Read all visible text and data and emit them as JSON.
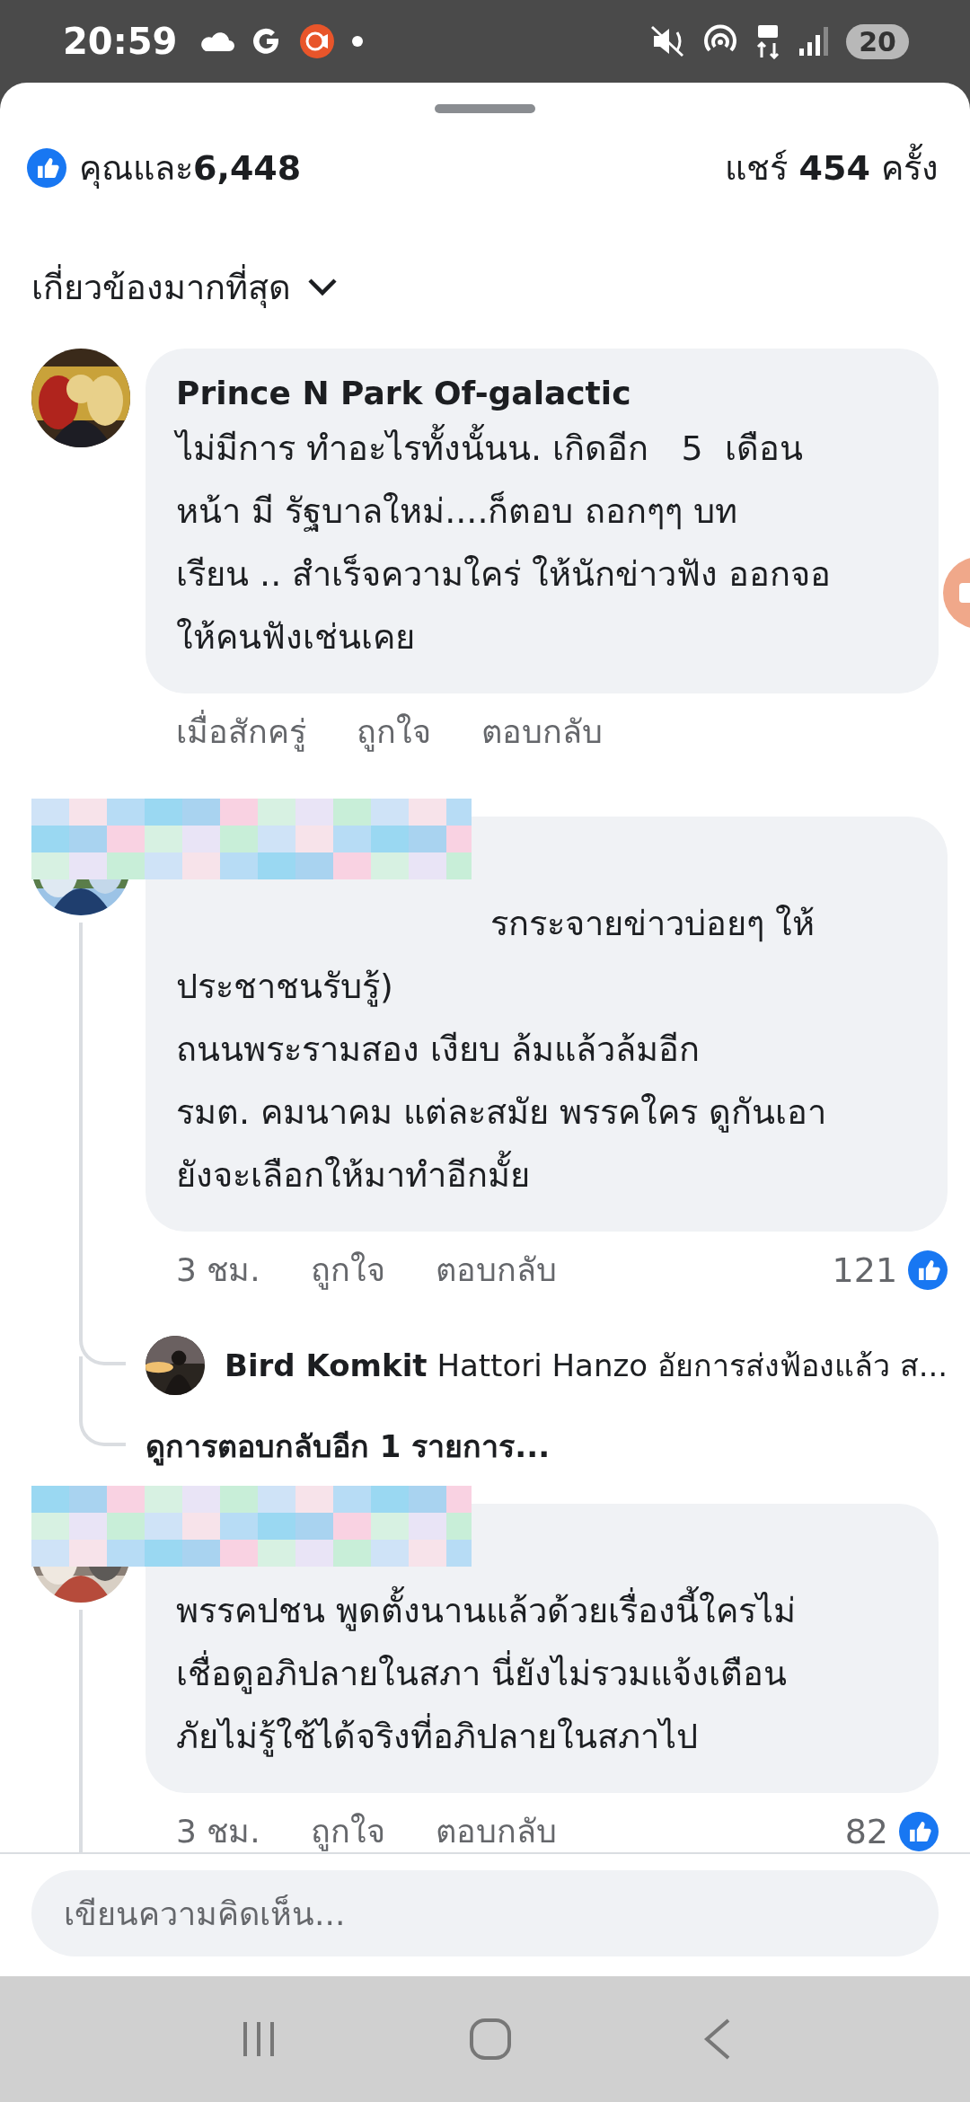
{
  "status_bar": {
    "time": "20:59",
    "battery": "20"
  },
  "reactions": {
    "summary": "คุณและ**6,448**",
    "shares": "แชร์ **454** ครั้ง"
  },
  "sort": {
    "label": "เกี่ยวข้องมากที่สุด"
  },
  "comments": [
    {
      "author": "Prince N Park Of-galactic",
      "redacted": false,
      "lines": [
        "ไม่มีการ ทำอะไรทั้งนั้นน. เกิดอีก   5  เดือน",
        "หน้า มี รัฐบาลใหม่....ก็ตอบ ถอกๆๆ บท",
        "เรียน .. สำเร็จความใคร่ ให้นักข่าวฟัง ออกจอ",
        "ให้คนฟังเช่นเคย"
      ],
      "time": "เมื่อสักครู่",
      "like": "ถูกใจ",
      "reply": "ตอบกลับ",
      "thread": false
    },
    {
      "redacted": true,
      "lines": [
        "รกระจายข่าวบ่อยๆ ให้",
        "ประชาชนรับรู้)",
        "ถนนพระรามสอง เงียบ ล้มแล้วล้มอีก",
        "รมต. คมนาคม แต่ละสมัย พรรคใคร ดูกันเอา",
        "ยังจะเลือกให้มาทำอีกมั้ย"
      ],
      "time": "3 ชม.",
      "like": "ถูกใจ",
      "reply": "ตอบกลับ",
      "like_count": "121",
      "thread": true,
      "reply_preview": {
        "author": "Bird Komkit",
        "text": "Hattori Hanzo อัยการส่งฟ้องแล้ว ส..."
      },
      "more_replies": "ดูการตอบกลับอีก 1 รายการ..."
    },
    {
      "redacted": true,
      "lines": [
        "พรรคปชน พูดตั้งนานแล้วด้วยเรื่องนี้ใครไม่",
        "เชื่อดูอภิปลายในสภา นี่ยังไม่รวมแจ้งเตือน",
        "ภัยไม่รู้ใช้ได้จริงที่อภิปลายในสภาไป"
      ],
      "time": "3 ชม.",
      "like": "ถูกใจ",
      "reply": "ตอบกลับ",
      "like_count": "82",
      "thread": true
    }
  ],
  "composer": {
    "placeholder": "เขียนความคิดเห็น..."
  }
}
